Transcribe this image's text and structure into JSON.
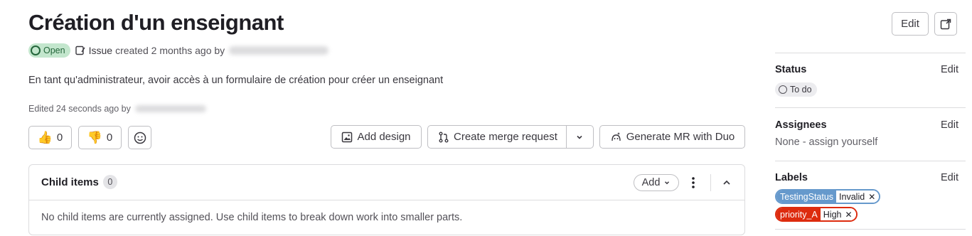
{
  "issue": {
    "title": "Création d'un enseignant",
    "status_badge": "Open",
    "type": "Issue",
    "created_text": "created 2 months ago by",
    "description": "En tant qu'administrateur, avoir accès à un formulaire de création pour créer un enseignant",
    "edited_text": "Edited 24 seconds ago by"
  },
  "header_actions": {
    "edit": "Edit"
  },
  "reactions": {
    "thumbs_up_count": "0",
    "thumbs_down_count": "0"
  },
  "actions": {
    "add_design": "Add design",
    "create_merge_request": "Create merge request",
    "generate_mr": "Generate MR with Duo"
  },
  "child_items": {
    "title": "Child items",
    "count": "0",
    "add": "Add",
    "empty_text": "No child items are currently assigned. Use child items to break down work into smaller parts."
  },
  "sidebar": {
    "status": {
      "title": "Status",
      "edit": "Edit",
      "value": "To do"
    },
    "assignees": {
      "title": "Assignees",
      "edit": "Edit",
      "value": "None - assign yourself"
    },
    "labels": {
      "title": "Labels",
      "edit": "Edit",
      "items": [
        {
          "key": "TestingStatus",
          "value": "Invalid",
          "color": "#6699cc"
        },
        {
          "key": "priority_A",
          "value": "High",
          "color": "#dd2b0e"
        }
      ]
    }
  },
  "colors": {
    "open_badge_bg": "#c3e6cd",
    "open_badge_fg": "#24663b"
  }
}
